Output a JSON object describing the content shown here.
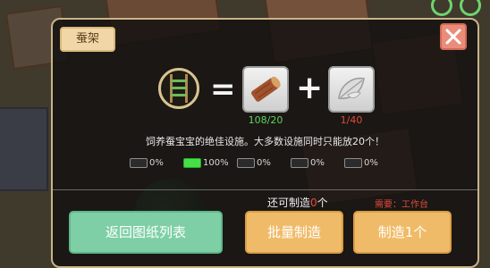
{
  "panel": {
    "title": "蚕架",
    "close_icon": "close-icon"
  },
  "recipe": {
    "result_icon": "silkworm-shelf-icon",
    "equals": "=",
    "plus": "+",
    "ingredients": [
      {
        "icon": "wood-log-icon",
        "count": "108/20",
        "status_color": "#5fd35f"
      },
      {
        "icon": "mulberry-leaf-icon",
        "count": "1/40",
        "status_color": "#e04a3a"
      }
    ]
  },
  "description": "饲养蚕宝宝的绝佳设施。大多数设施同时只能放20个！",
  "percentages": [
    {
      "label": "0%",
      "active": false
    },
    {
      "label": "100%",
      "active": true
    },
    {
      "label": "0%",
      "active": false
    },
    {
      "label": "0%",
      "active": false
    },
    {
      "label": "0%",
      "active": false
    }
  ],
  "footer": {
    "can_make_prefix": "还可制造",
    "can_make_count": "0",
    "can_make_suffix": "个",
    "need_text": "需要：工作台"
  },
  "buttons": {
    "back": "返回图纸列表",
    "batch": "批量制造",
    "make_one": "制造1个"
  },
  "colors": {
    "panel_border": "#c9b48a",
    "back_button": "#7ecfa6",
    "make_button": "#f0bb68",
    "warning": "#e04a3a",
    "ok": "#5fd35f"
  }
}
